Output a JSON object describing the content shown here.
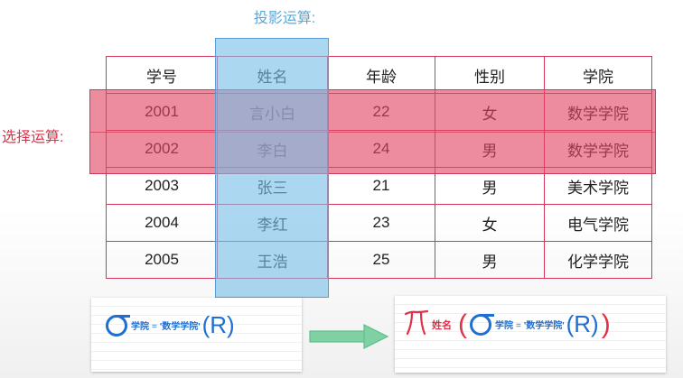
{
  "labels": {
    "projection": "投影运算:",
    "selection": "选择运算:"
  },
  "table": {
    "headers": [
      "学号",
      "姓名",
      "年龄",
      "性别",
      "学院"
    ],
    "rows": [
      [
        "2001",
        "言小白",
        "22",
        "女",
        "数学学院"
      ],
      [
        "2002",
        "李白",
        "24",
        "男",
        "数学学院"
      ],
      [
        "2003",
        "张三",
        "21",
        "男",
        "美术学院"
      ],
      [
        "2004",
        "李红",
        "23",
        "女",
        "电气学院"
      ],
      [
        "2005",
        "王浩",
        "25",
        "男",
        "化学学院"
      ]
    ]
  },
  "formulas": {
    "selection": {
      "attr": "学院",
      "eq": "=",
      "value": "'数学学院'",
      "relation": "(R)"
    },
    "projection": {
      "attr": "姓名",
      "open": "(",
      "close": ")",
      "inner_attr": "学院",
      "inner_eq": "=",
      "inner_value": "'数学学院'",
      "inner_relation": "(R)"
    }
  },
  "colors": {
    "selection": "#e0314a",
    "projection": "#5aa8d8",
    "formula_blue": "#1f6fd1",
    "arrow": "#5fbf8a"
  }
}
